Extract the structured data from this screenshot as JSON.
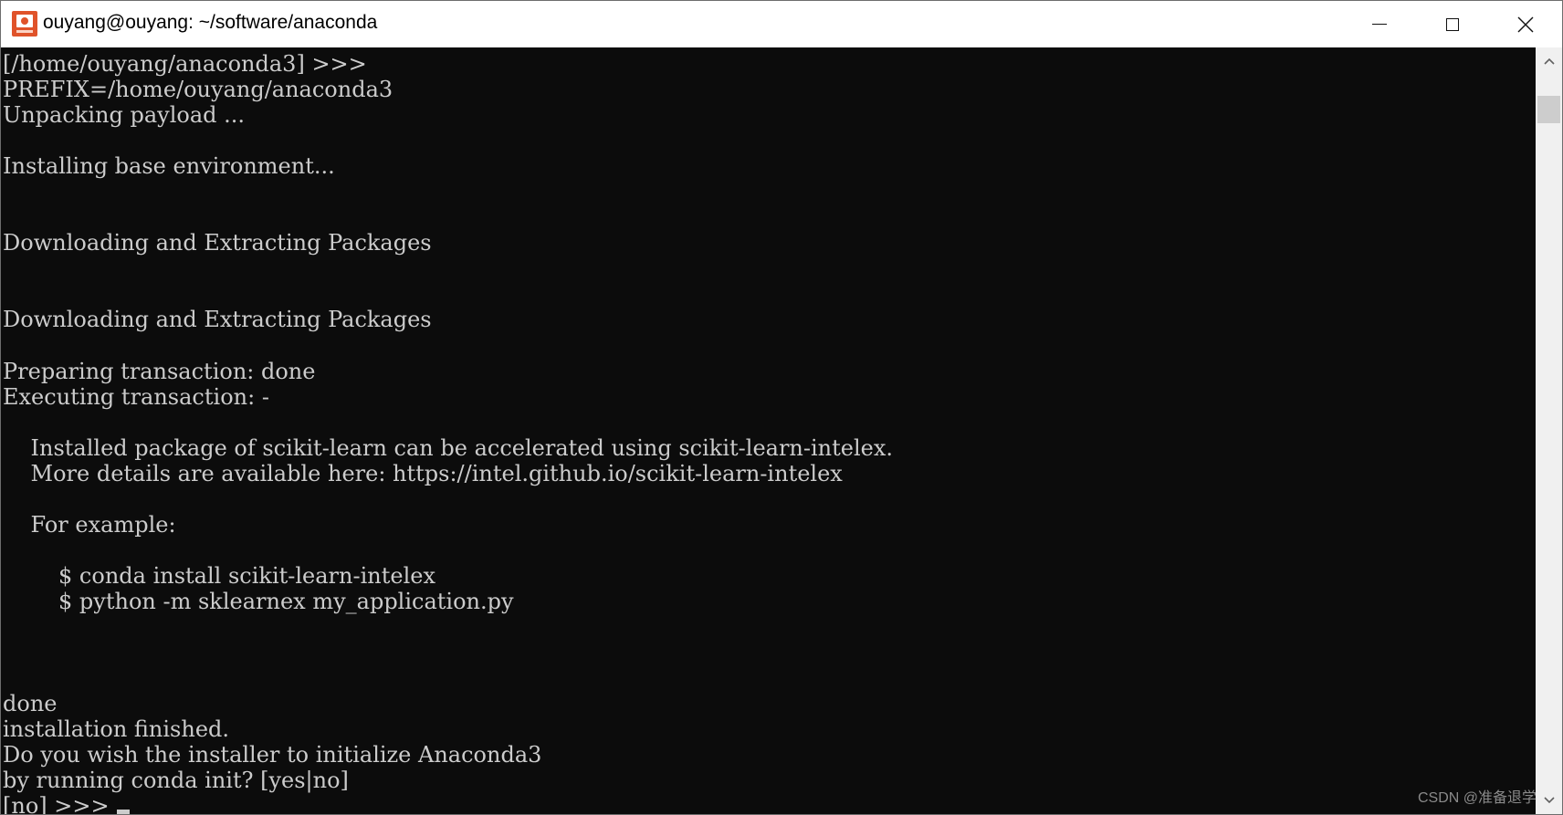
{
  "window": {
    "title": "ouyang@ouyang: ~/software/anaconda",
    "controls": {
      "minimize": "minimize-icon",
      "maximize": "maximize-icon",
      "close": "close-icon"
    }
  },
  "terminal": {
    "lines": [
      "[/home/ouyang/anaconda3] >>>",
      "PREFIX=/home/ouyang/anaconda3",
      "Unpacking payload ...",
      "",
      "Installing base environment...",
      "",
      "",
      "Downloading and Extracting Packages",
      "",
      "",
      "Downloading and Extracting Packages",
      "",
      "Preparing transaction: done",
      "Executing transaction: -",
      "",
      "    Installed package of scikit-learn can be accelerated using scikit-learn-intelex.",
      "    More details are available here: https://intel.github.io/scikit-learn-intelex",
      "",
      "    For example:",
      "",
      "        $ conda install scikit-learn-intelex",
      "        $ python -m sklearnex my_application.py",
      "",
      "",
      "",
      "done",
      "installation finished.",
      "Do you wish the installer to initialize Anaconda3",
      "by running conda init? [yes|no]",
      "[no] >>> "
    ]
  },
  "scrollbar": {
    "up_icon": "chevron-up-icon",
    "down_icon": "chevron-down-icon"
  },
  "watermark": "CSDN @准备退学"
}
